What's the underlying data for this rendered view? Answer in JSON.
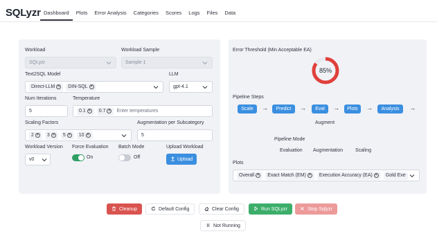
{
  "app": {
    "title": "SQLyzr"
  },
  "tabs": [
    {
      "label": "Dashboard"
    },
    {
      "label": "Plots"
    },
    {
      "label": "Error Analysis"
    },
    {
      "label": "Categories"
    },
    {
      "label": "Scores"
    },
    {
      "label": "Logs"
    },
    {
      "label": "Files"
    },
    {
      "label": "Data"
    }
  ],
  "left": {
    "workload": {
      "label": "Workload",
      "value": "SQLyzr"
    },
    "workload_sample": {
      "label": "Workload Sample",
      "value": "Sample 1"
    },
    "text2sql_model": {
      "label": "Text2SQL Model",
      "chips": [
        "Direct-LLM",
        "DIN-SQL"
      ]
    },
    "llm": {
      "label": "LLM",
      "value": "gpt-4.1"
    },
    "num_iterations": {
      "label": "Num Iterations",
      "value": "5"
    },
    "temperature": {
      "label": "Temperature",
      "chips": [
        "0.1",
        "0.7"
      ],
      "placeholder": "Enter temperatures"
    },
    "scaling_factors": {
      "label": "Scaling Factors",
      "chips": [
        "2",
        "3",
        "5",
        "10"
      ]
    },
    "augmentation": {
      "label": "Augmentation per Subcategory",
      "value": "5"
    },
    "workload_version": {
      "label": "Workload Version",
      "value": "v0"
    },
    "force_evaluation": {
      "label": "Force Evaluation",
      "state": "On",
      "on": true
    },
    "batch_mode": {
      "label": "Batch Mode",
      "state": "Off",
      "on": false
    },
    "upload_workload": {
      "label": "Upload Workload",
      "button": "Upload"
    }
  },
  "right": {
    "threshold": {
      "label": "Error Threshold (Min Acceptable EA)",
      "value_text": "85%",
      "percent": 85
    },
    "pipeline": {
      "label": "Pipeline Steps",
      "steps": [
        "Scale",
        "Predict",
        "Eval",
        "Plots",
        "Analysis"
      ],
      "extra": "Augment"
    },
    "mode": {
      "label": "Pipeline Mode",
      "options": [
        "Evaluation",
        "Augmentation",
        "Scaling"
      ]
    },
    "plots": {
      "label": "Plots",
      "chips": [
        "Overall",
        "Exact Match (EM)",
        "Execution Accuracy (EA)",
        "Gold Exe"
      ]
    }
  },
  "actions": {
    "cleanup": "Cleanup",
    "default_config": "Default Config",
    "clear_config": "Clear Config",
    "run": "Run SQLyzr",
    "stop": "Stop Sqlyzr",
    "status": "Not Running"
  },
  "colors": {
    "accent": "#3b8fe0",
    "danger": "#d9534f",
    "success": "#3cae6a",
    "gauge": "#e0403a"
  }
}
